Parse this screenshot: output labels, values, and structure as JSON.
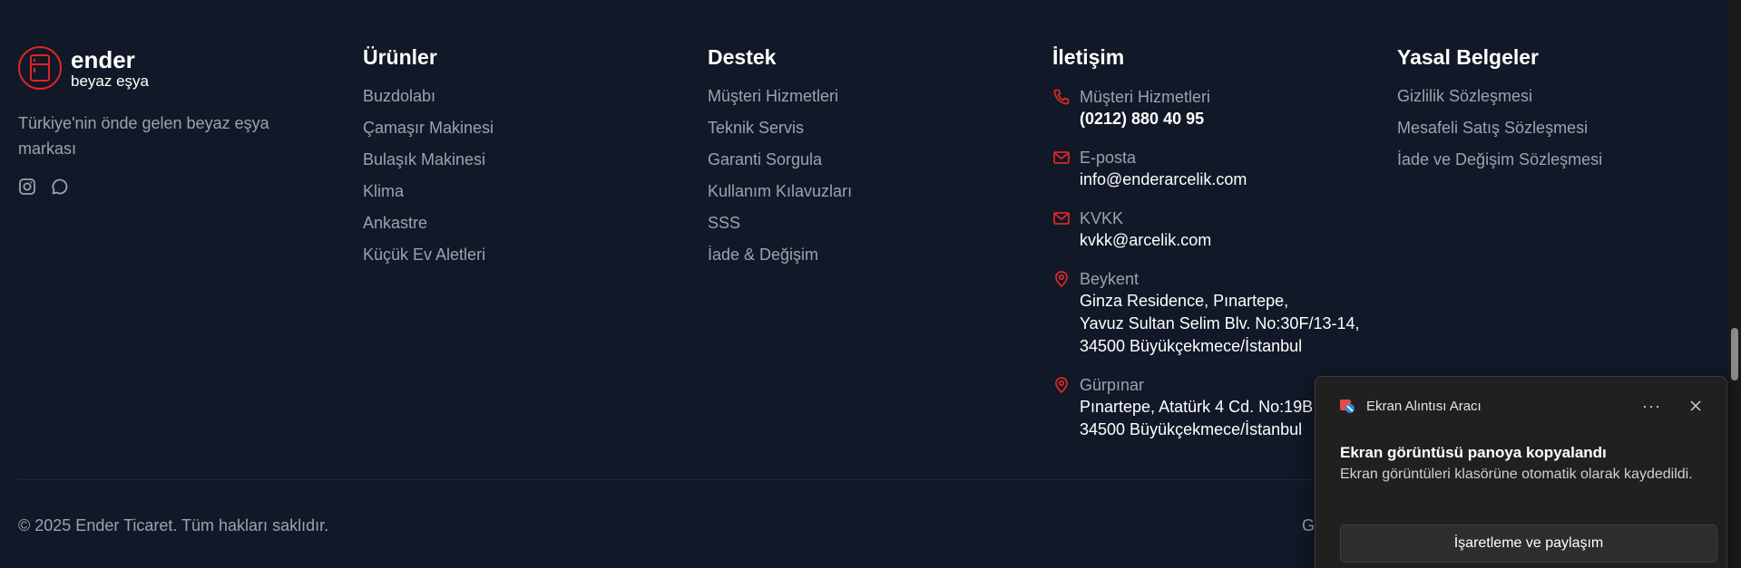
{
  "brand": {
    "name": "ender",
    "subtitle": "beyaz eşya",
    "tagline": "Türkiye'nin önde gelen beyaz eşya markası",
    "accent_color": "#dc2626",
    "social_icons": [
      "instagram-icon",
      "chat-icon"
    ]
  },
  "products": {
    "heading": "Ürünler",
    "items": [
      "Buzdolabı",
      "Çamaşır Makinesi",
      "Bulaşık Makinesi",
      "Klima",
      "Ankastre",
      "Küçük Ev Aletleri"
    ]
  },
  "support": {
    "heading": "Destek",
    "items": [
      "Müşteri Hizmetleri",
      "Teknik Servis",
      "Garanti Sorgula",
      "Kullanım Kılavuzları",
      "SSS",
      "İade & Değişim"
    ]
  },
  "contact": {
    "heading": "İletişim",
    "phone": {
      "icon": "phone-icon",
      "label": "Müşteri Hizmetleri",
      "value": "(0212) 880 40 95"
    },
    "email": {
      "icon": "mail-icon",
      "label": "E-posta",
      "value": "info@enderarcelik.com"
    },
    "kvkk": {
      "icon": "mail-icon",
      "label": "KVKK",
      "value": "kvkk@arcelik.com"
    },
    "beykent": {
      "icon": "location-pin-icon",
      "label": "Beykent",
      "lines": [
        "Ginza Residence, Pınartepe,",
        "Yavuz Sultan Selim Blv. No:30F/13-14,",
        "34500 Büyükçekmece/İstanbul"
      ]
    },
    "gurpinar": {
      "icon": "location-pin-icon",
      "label": "Gürpınar",
      "lines": [
        "Pınartepe, Atatürk 4 Cd. No:19B",
        "34500 Büyükçekmece/İstanbul"
      ]
    }
  },
  "legal": {
    "heading": "Yasal Belgeler",
    "items": [
      "Gizlilik Sözleşmesi",
      "Mesafeli Satış Sözleşmesi",
      "İade ve Değişim Sözleşmesi"
    ]
  },
  "bottom": {
    "copyright": "© 2025 Ender Ticaret. Tüm hakları saklıdır.",
    "partial_link": "G"
  },
  "notification": {
    "app_name": "Ekran Alıntısı Aracı",
    "more_label": "···",
    "title": "Ekran görüntüsü panoya kopyalandı",
    "text": "Ekran görüntüleri klasörüne otomatik olarak kaydedildi.",
    "button_label": "İşaretleme ve paylaşım"
  }
}
